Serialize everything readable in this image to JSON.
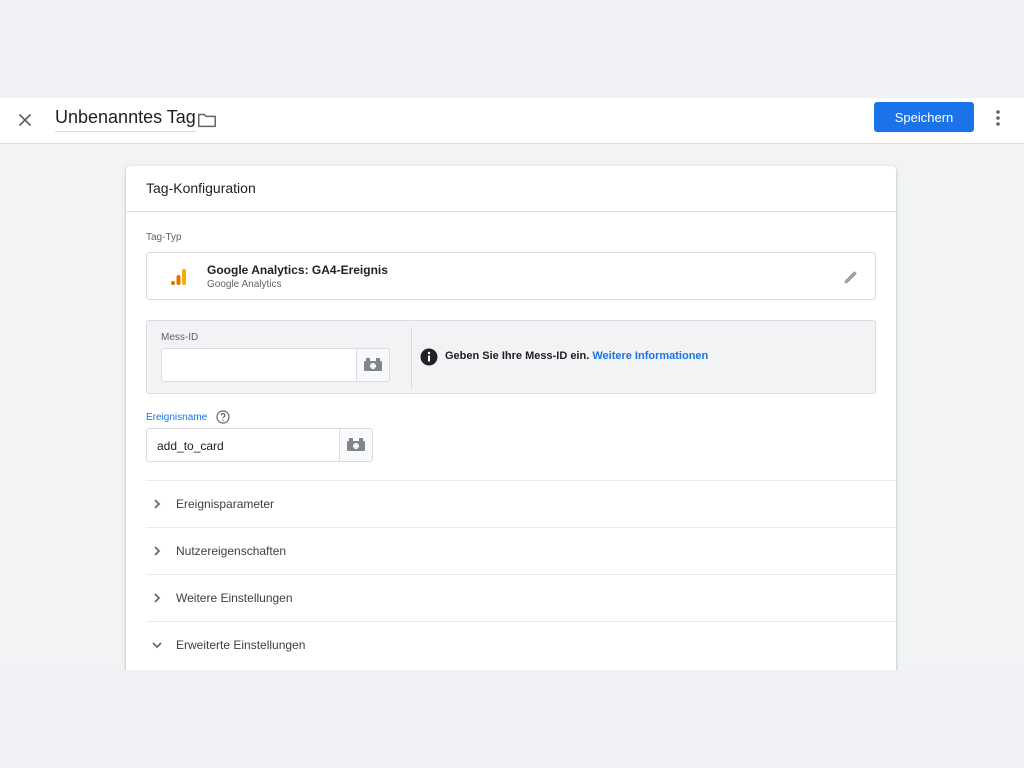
{
  "topbar": {
    "title": "Unbenanntes Tag",
    "save_label": "Speichern",
    "accent": "#1a73e8"
  },
  "card": {
    "header": "Tag-Konfiguration",
    "tag_type_label": "Tag-Typ",
    "tag_type": {
      "name": "Google Analytics: GA4-Ereignis",
      "subtitle": "Google Analytics",
      "icon": "google-analytics-icon"
    },
    "measurement": {
      "label": "Mess-ID",
      "value": "",
      "info_text": "Geben Sie Ihre Mess-ID ein.",
      "info_link": "Weitere Informationen"
    },
    "event": {
      "label": "Ereignisname",
      "value": "add_to_card"
    },
    "sections": [
      {
        "label": "Ereignisparameter",
        "expanded": false
      },
      {
        "label": "Nutzereigenschaften",
        "expanded": false
      },
      {
        "label": "Weitere Einstellungen",
        "expanded": false
      },
      {
        "label": "Erweiterte Einstellungen",
        "expanded": true
      }
    ]
  }
}
